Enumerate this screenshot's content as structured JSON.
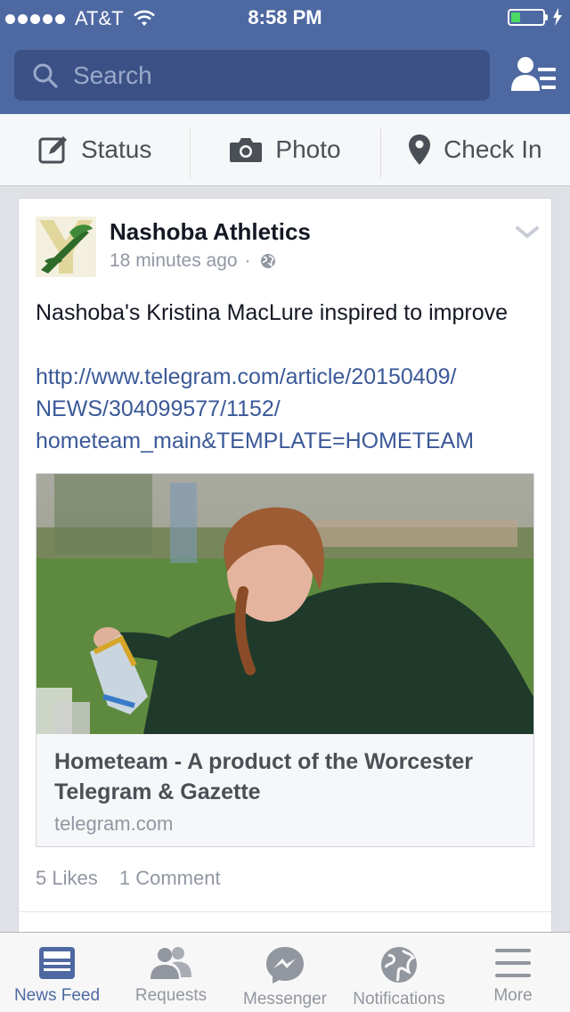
{
  "status_bar": {
    "carrier": "AT&T",
    "time": "8:58 PM",
    "battery_level": 0.3
  },
  "search": {
    "placeholder": "Search"
  },
  "composer": {
    "status": "Status",
    "photo": "Photo",
    "checkin": "Check In"
  },
  "post": {
    "page_name": "Nashoba Athletics",
    "time_ago": "18 minutes ago",
    "separator": "·",
    "text": "Nashoba's Kristina MacLure inspired to improve",
    "link_lines": [
      "http://www.telegram.com/article/20150409/",
      "NEWS/304099577/1152/",
      "hometeam_main&TEMPLATE=HOMETEAM"
    ],
    "share": {
      "title": "Hometeam - A product of the Worcester Telegram & Gazette",
      "domain": "telegram.com"
    },
    "likes": "5 Likes",
    "comments": "1 Comment"
  },
  "tabs": [
    {
      "label": "News Feed",
      "icon": "news-feed-icon",
      "active": true
    },
    {
      "label": "Requests",
      "icon": "friend-requests-icon",
      "active": false
    },
    {
      "label": "Messenger",
      "icon": "messenger-icon",
      "active": false
    },
    {
      "label": "Notifications",
      "icon": "globe-icon",
      "active": false
    },
    {
      "label": "More",
      "icon": "menu-icon",
      "active": false
    }
  ],
  "colors": {
    "brand_blue": "#4e69a2",
    "search_bg": "#3b5186",
    "link": "#3b5998",
    "battery_green": "#4cd964"
  }
}
